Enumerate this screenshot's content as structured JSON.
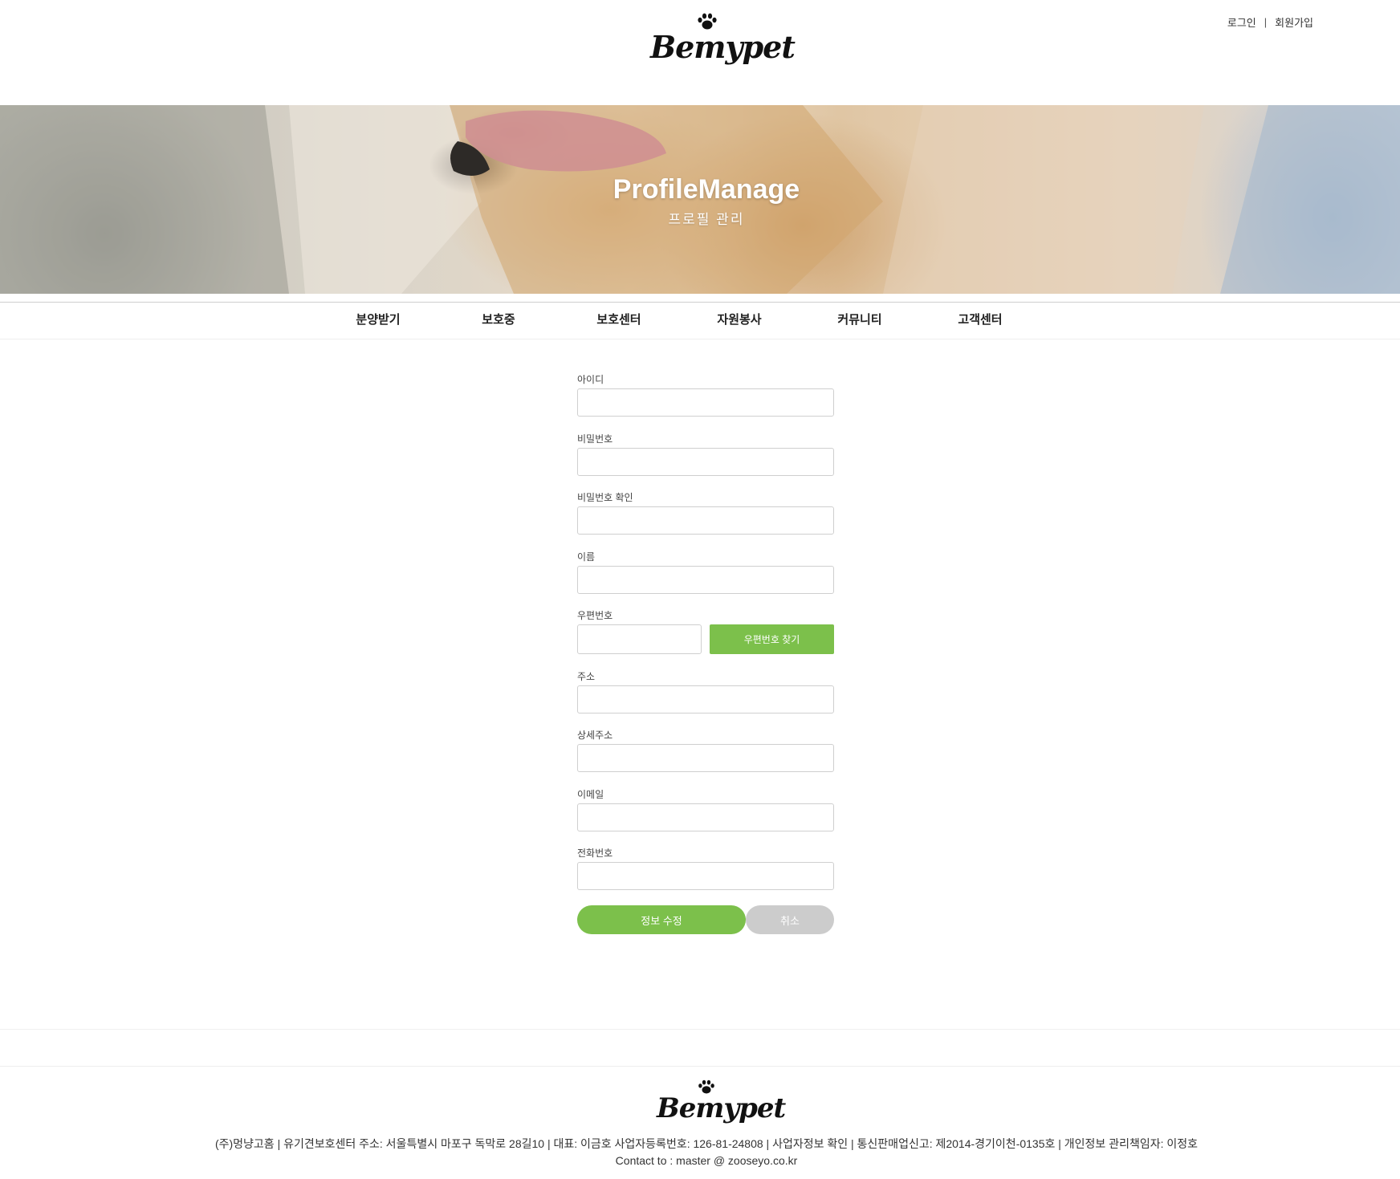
{
  "header": {
    "logo_text": "Bemypet",
    "login_label": "로그인",
    "separator": "|",
    "signup_label": "회원가입"
  },
  "hero": {
    "title": "ProfileManage",
    "subtitle": "프로필 관리"
  },
  "nav": {
    "items": [
      {
        "label": "분양받기"
      },
      {
        "label": "보호중"
      },
      {
        "label": "보호센터"
      },
      {
        "label": "자원봉사"
      },
      {
        "label": "커뮤니티"
      },
      {
        "label": "고객센터"
      }
    ]
  },
  "form": {
    "id_label": "아이디",
    "id_value": "",
    "password_label": "비밀번호",
    "password_value": "",
    "password_confirm_label": "비밀번호 확인",
    "password_confirm_value": "",
    "name_label": "이름",
    "name_value": "",
    "zip_label": "우편번호",
    "zip_value": "",
    "zip_button_label": "우편번호 찾기",
    "address_label": "주소",
    "address_value": "",
    "address_detail_label": "상세주소",
    "address_detail_value": "",
    "email_label": "이메일",
    "email_value": "",
    "phone_label": "전화번호",
    "phone_value": "",
    "submit_label": "정보 수정",
    "cancel_label": "취소"
  },
  "footer": {
    "logo_text": "Bemypet",
    "info": "(주)멍냥고홈  |  유기견보호센터 주소: 서울특별시 마포구 독막로 28길10  |  대표: 이금호 사업자등록번호: 126-81-24808  |  사업자정보 확인  |  통신판매업신고: 제2014-경기이천-0135호  |  개인정보 관리책임자: 이정호",
    "contact": "Contact to : master @ zooseyo.co.kr"
  },
  "colors": {
    "accent": "#7cc04b",
    "cancel": "#cccccc"
  }
}
